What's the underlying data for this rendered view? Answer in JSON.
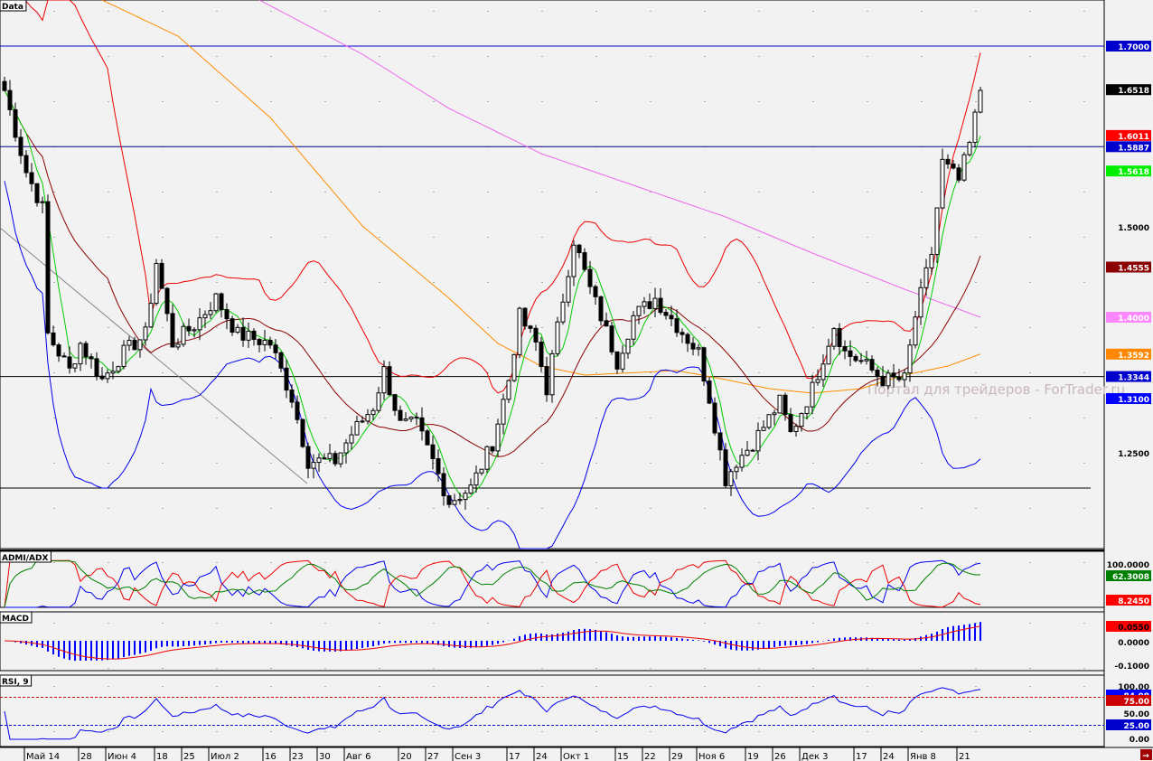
{
  "panels": {
    "main": "Data",
    "adx": "ADMI/ADX",
    "macd": "MACD",
    "rsi": "RSI, 9"
  },
  "watermark": "Портал для трейдеров - ForTrader.ru",
  "chart_data": {
    "type": "candlestick",
    "price_range": [
      1.144,
      1.751
    ],
    "close_keypoints": [
      [
        0,
        1.651
      ],
      [
        4,
        1.561
      ],
      [
        7,
        1.521
      ],
      [
        8,
        1.381
      ],
      [
        12,
        1.341
      ],
      [
        14,
        1.371
      ],
      [
        18,
        1.331
      ],
      [
        22,
        1.361
      ],
      [
        26,
        1.381
      ],
      [
        28,
        1.461
      ],
      [
        31,
        1.371
      ],
      [
        35,
        1.391
      ],
      [
        39,
        1.421
      ],
      [
        43,
        1.381
      ],
      [
        49,
        1.371
      ],
      [
        53,
        1.311
      ],
      [
        56,
        1.241
      ],
      [
        61,
        1.241
      ],
      [
        64,
        1.271
      ],
      [
        68,
        1.301
      ],
      [
        70,
        1.341
      ],
      [
        73,
        1.281
      ],
      [
        76,
        1.281
      ],
      [
        79,
        1.241
      ],
      [
        82,
        1.196
      ],
      [
        86,
        1.211
      ],
      [
        90,
        1.261
      ],
      [
        93,
        1.331
      ],
      [
        95,
        1.401
      ],
      [
        98,
        1.371
      ],
      [
        100,
        1.321
      ],
      [
        103,
        1.421
      ],
      [
        105,
        1.486
      ],
      [
        108,
        1.431
      ],
      [
        110,
        1.401
      ],
      [
        113,
        1.351
      ],
      [
        116,
        1.401
      ],
      [
        120,
        1.421
      ],
      [
        124,
        1.391
      ],
      [
        128,
        1.361
      ],
      [
        130,
        1.311
      ],
      [
        133,
        1.221
      ],
      [
        135,
        1.241
      ],
      [
        138,
        1.261
      ],
      [
        143,
        1.306
      ],
      [
        145,
        1.271
      ],
      [
        149,
        1.321
      ],
      [
        153,
        1.391
      ],
      [
        155,
        1.361
      ],
      [
        158,
        1.351
      ],
      [
        162,
        1.331
      ],
      [
        166,
        1.331
      ],
      [
        168,
        1.401
      ],
      [
        171,
        1.471
      ],
      [
        173,
        1.571
      ],
      [
        176,
        1.551
      ],
      [
        178,
        1.591
      ],
      [
        180,
        1.651
      ]
    ],
    "ma_orange_keypoints": [
      [
        18,
        1.751
      ],
      [
        32,
        1.711
      ],
      [
        49,
        1.621
      ],
      [
        66,
        1.501
      ],
      [
        82,
        1.421
      ],
      [
        91,
        1.371
      ],
      [
        99,
        1.346
      ],
      [
        107,
        1.336
      ],
      [
        124,
        1.341
      ],
      [
        133,
        1.331
      ],
      [
        141,
        1.321
      ],
      [
        149,
        1.316
      ],
      [
        158,
        1.321
      ],
      [
        166,
        1.336
      ],
      [
        174,
        1.346
      ],
      [
        180,
        1.3592
      ]
    ],
    "ma_violet_keypoints": [
      [
        47,
        1.751
      ],
      [
        66,
        1.691
      ],
      [
        82,
        1.631
      ],
      [
        99,
        1.581
      ],
      [
        116,
        1.546
      ],
      [
        133,
        1.511
      ],
      [
        149,
        1.471
      ],
      [
        166,
        1.431
      ],
      [
        180,
        1.4
      ]
    ],
    "hlines": [
      {
        "price": 1.7,
        "label": "1.7000",
        "color": "#0000cc"
      },
      {
        "price": 1.5887,
        "label": "1.5887",
        "color": "#000080"
      },
      {
        "price": 1.3344,
        "label": "1.3344",
        "color": "#000000"
      },
      {
        "price": 1.211,
        "label": "",
        "color": "#000000"
      }
    ],
    "price_labels": [
      {
        "price": 1.7,
        "text": "1.7000",
        "bg": "#0000cc",
        "fg": "#ffffff"
      },
      {
        "price": 1.6518,
        "text": "1.6518",
        "bg": "#000000",
        "fg": "#ffffff"
      },
      {
        "price": 1.6011,
        "text": "1.6011",
        "bg": "#ff0000",
        "fg": "#ffffff"
      },
      {
        "price": 1.5887,
        "text": "1.5887",
        "bg": "#0000cc",
        "fg": "#ffffff"
      },
      {
        "price": 1.5618,
        "text": "1.5618",
        "bg": "#00ee00",
        "fg": "#ffffff"
      },
      {
        "price": 1.5,
        "text": "1.5000",
        "bg": "",
        "fg": "#000000"
      },
      {
        "price": 1.4555,
        "text": "1.4555",
        "bg": "#8b0000",
        "fg": "#ffffff"
      },
      {
        "price": 1.4,
        "text": "1.4000",
        "bg": "#ff88ff",
        "fg": "#ffffff"
      },
      {
        "price": 1.3592,
        "text": "1.3592",
        "bg": "#ff8800",
        "fg": "#ffffff"
      },
      {
        "price": 1.3344,
        "text": "1.3344",
        "bg": "#0000cc",
        "fg": "#ffffff"
      },
      {
        "price": 1.31,
        "text": "1.3100",
        "bg": "#0000ff",
        "fg": "#ffffff"
      },
      {
        "price": 1.25,
        "text": "1.2500",
        "bg": "",
        "fg": "#000000"
      }
    ],
    "adx_labels": [
      {
        "text": "100.0000",
        "bg": "",
        "fg": "#000"
      },
      {
        "text": "62.3008",
        "bg": "#008000",
        "fg": "#fff"
      },
      {
        "text": "8.2450",
        "bg": "#ff0000",
        "fg": "#fff"
      }
    ],
    "macd_labels": [
      {
        "text": "0.0550",
        "bg": "#ff0000",
        "fg": "#000"
      },
      {
        "text": "0.0000",
        "bg": "",
        "fg": "#000"
      },
      {
        "text": "-0.1000",
        "bg": "",
        "fg": "#000"
      }
    ],
    "rsi_labels": [
      {
        "text": "100.00",
        "bg": "",
        "fg": "#000"
      },
      {
        "text": "84.08",
        "bg": "#0000ff",
        "fg": "#fff"
      },
      {
        "text": "75.00",
        "bg": "#cc0000",
        "fg": "#fff"
      },
      {
        "text": "50.00",
        "bg": "",
        "fg": "#000"
      },
      {
        "text": "25.00",
        "bg": "#0000cc",
        "fg": "#fff"
      },
      {
        "text": "0.00",
        "bg": "",
        "fg": "#000"
      }
    ],
    "rsi_levels": [
      75,
      25
    ],
    "x_labels": [
      [
        "Май 14",
        4
      ],
      [
        "28",
        14
      ],
      [
        "Июн 4",
        19
      ],
      [
        "18",
        28
      ],
      [
        "25",
        33
      ],
      [
        "Июл 2",
        38
      ],
      [
        "16",
        48
      ],
      [
        "23",
        53
      ],
      [
        "30",
        58
      ],
      [
        "Авг 6",
        63
      ],
      [
        "20",
        73
      ],
      [
        "27",
        78
      ],
      [
        "Сен 3",
        83
      ],
      [
        "17",
        93
      ],
      [
        "24",
        98
      ],
      [
        "Окт 1",
        103
      ],
      [
        "15",
        113
      ],
      [
        "22",
        118
      ],
      [
        "29",
        123
      ],
      [
        "Ноя 6",
        128
      ],
      [
        "19",
        137
      ],
      [
        "26",
        142
      ],
      [
        "Дек 3",
        147
      ],
      [
        "17",
        157
      ],
      [
        "24",
        162
      ],
      [
        "Янв 8",
        167
      ],
      [
        "21",
        176
      ]
    ]
  }
}
